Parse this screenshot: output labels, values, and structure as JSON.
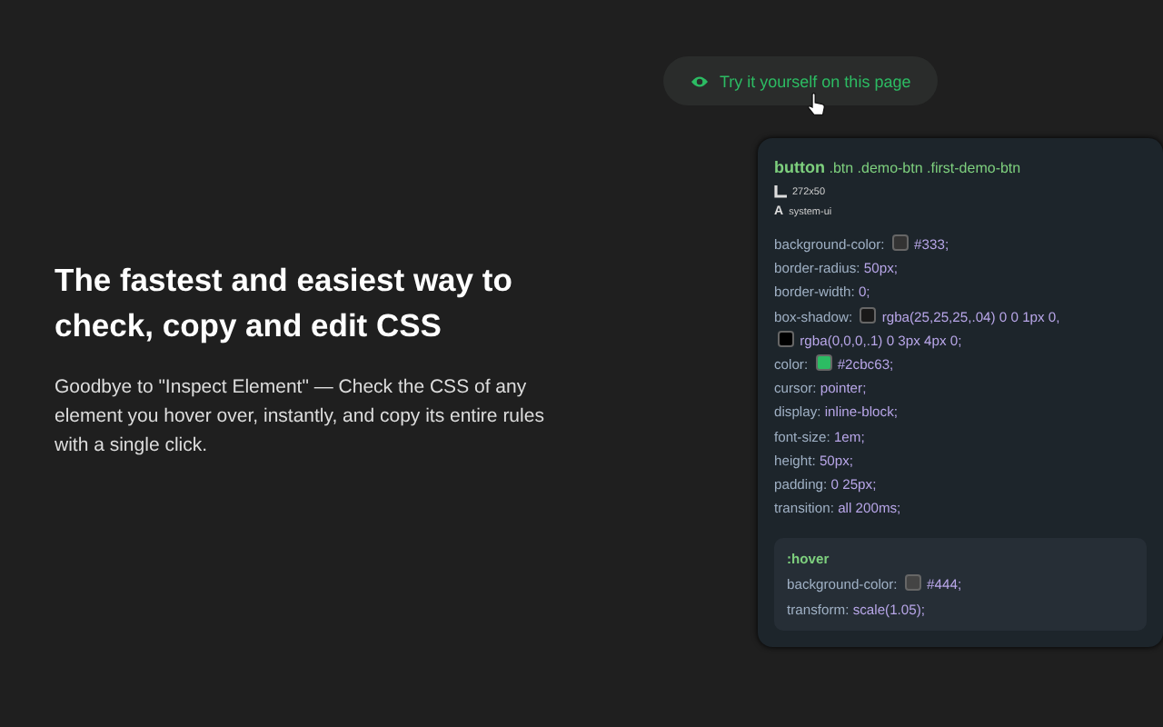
{
  "try_button": {
    "label": "Try it yourself on this page"
  },
  "headline": "The fastest and easiest way to check, copy and edit CSS",
  "description": "Goodbye to \"Inspect Element\" — Check the CSS of any element you hover over, instantly, and copy its entire rules with a single click.",
  "inspector": {
    "tag": "button",
    "classes": ".btn .demo-btn .first-demo-btn",
    "size": "272x50",
    "font_icon": "A",
    "font": "system-ui",
    "declarations": [
      {
        "property": "background-color:",
        "parts": [
          {
            "color": "#333333",
            "text": "#333;"
          }
        ]
      },
      {
        "property": "border-radius:",
        "parts": [
          {
            "text": "50px;"
          }
        ]
      },
      {
        "property": "border-width:",
        "parts": [
          {
            "text": "0;"
          }
        ]
      },
      {
        "property": "box-shadow:",
        "parts": [
          {
            "color": "#191919",
            "text": "rgba(25,25,25,.04) 0 0 1px 0,"
          },
          {
            "color": "#000000",
            "text": "rgba(0,0,0,.1) 0 3px 4px 0;"
          }
        ]
      },
      {
        "property": "color:",
        "parts": [
          {
            "color": "#2cbc63",
            "text": "#2cbc63;"
          }
        ]
      },
      {
        "property": "cursor:",
        "parts": [
          {
            "text": "pointer;"
          }
        ]
      },
      {
        "property": "display:",
        "parts": [
          {
            "text": "inline-block;"
          }
        ]
      },
      {
        "property": "font-size:",
        "parts": [
          {
            "text": "1em;"
          }
        ]
      },
      {
        "property": "height:",
        "parts": [
          {
            "text": "50px;"
          }
        ]
      },
      {
        "property": "padding:",
        "parts": [
          {
            "text": "0 25px;"
          }
        ]
      },
      {
        "property": "transition:",
        "parts": [
          {
            "text": "all 200ms;"
          }
        ]
      }
    ],
    "hover": {
      "selector": ":hover",
      "declarations": [
        {
          "property": "background-color:",
          "parts": [
            {
              "color": "#444444",
              "text": "#444;"
            }
          ]
        },
        {
          "property": "transform:",
          "parts": [
            {
              "text": "scale(1.05);"
            }
          ]
        }
      ]
    }
  }
}
